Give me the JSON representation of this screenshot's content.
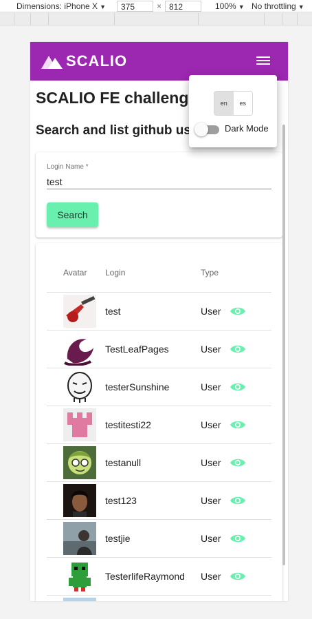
{
  "devtools": {
    "dimensions_label": "Dimensions: iPhone X",
    "width_value": "375",
    "separator": "×",
    "height_value": "812",
    "zoom": "100%",
    "throttling": "No throttling"
  },
  "app": {
    "brand": "SCALIO",
    "accent_color": "#9c27b0",
    "button_color": "#69f0ae",
    "page_title": "SCALIO FE challenge",
    "subtitle": "Search and list github users"
  },
  "search": {
    "label": "Login Name *",
    "value": "test",
    "button_label": "Search"
  },
  "table": {
    "headers": {
      "avatar": "Avatar",
      "login": "Login",
      "type": "Type"
    },
    "rows": [
      {
        "login": "test",
        "type": "User",
        "icon": "eye-icon"
      },
      {
        "login": "TestLeafPages",
        "type": "User",
        "icon": "eye-icon"
      },
      {
        "login": "testerSunshine",
        "type": "User",
        "icon": "eye-icon"
      },
      {
        "login": "testitesti22",
        "type": "User",
        "icon": "eye-icon"
      },
      {
        "login": "testanull",
        "type": "User",
        "icon": "eye-icon"
      },
      {
        "login": "test123",
        "type": "User",
        "icon": "eye-icon"
      },
      {
        "login": "testjie",
        "type": "User",
        "icon": "eye-icon"
      },
      {
        "login": "TesterlifeRaymond",
        "type": "User",
        "icon": "eye-icon"
      }
    ]
  },
  "settings": {
    "languages": [
      "en",
      "es"
    ],
    "selected_language": "en",
    "dark_mode_label": "Dark Mode",
    "dark_mode_on": false
  }
}
